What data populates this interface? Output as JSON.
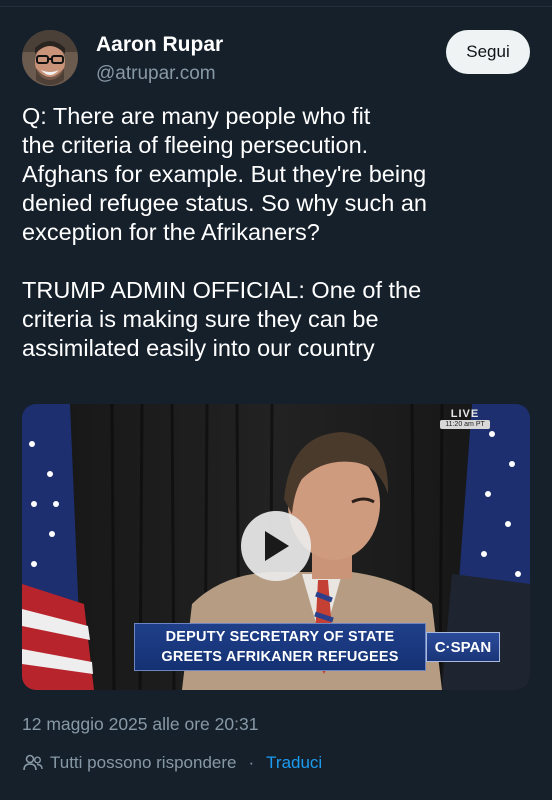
{
  "author": {
    "name": "Aaron Rupar",
    "handle": "@atrupar.com",
    "avatar_icon": "user-avatar"
  },
  "follow_label": "Segui",
  "tweet": {
    "text": "Q: There are many people who fit\nthe criteria of fleeing persecution.\nAfghans for example. But they're being\ndenied refugee status. So why such an\nexception for the Afrikaners?\n\nTRUMP ADMIN OFFICIAL: One of the\ncriteria is making sure they can be\nassimilated easily into our country"
  },
  "video": {
    "live_label": "LIVE",
    "live_time": "11:20 am PT",
    "lower_third_line1": "DEPUTY SECRETARY OF STATE",
    "lower_third_line2": "GREETS AFRIKANER REFUGEES",
    "network": "C·SPAN",
    "play_icon": "play-icon"
  },
  "meta": {
    "timestamp": "12 maggio 2025 alle ore 20:31",
    "reply_setting": "Tutti possono rispondere",
    "separator": "·",
    "translate_label": "Traduci"
  },
  "colors": {
    "background": "#15202b",
    "secondary_text": "#8899a6",
    "link": "#1d9bf0",
    "lower_third": "#1f3f8a"
  }
}
